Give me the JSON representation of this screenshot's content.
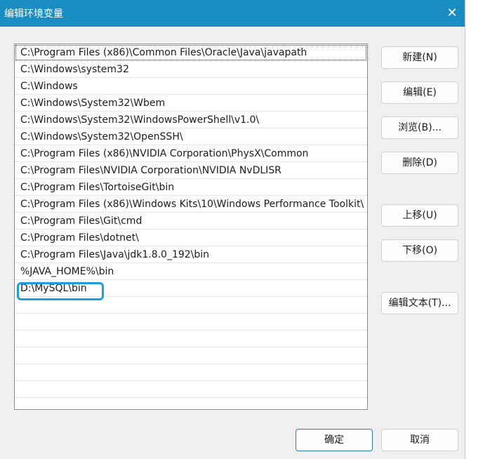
{
  "window": {
    "title": "编辑环境变量",
    "close_glyph": "✕"
  },
  "paths": [
    "C:\\Program Files (x86)\\Common Files\\Oracle\\Java\\javapath",
    "C:\\Windows\\system32",
    "C:\\Windows",
    "C:\\Windows\\System32\\Wbem",
    "C:\\Windows\\System32\\WindowsPowerShell\\v1.0\\",
    "C:\\Windows\\System32\\OpenSSH\\",
    "C:\\Program Files (x86)\\NVIDIA Corporation\\PhysX\\Common",
    "C:\\Program Files\\NVIDIA Corporation\\NVIDIA NvDLISR",
    "C:\\Program Files\\TortoiseGit\\bin",
    "C:\\Program Files (x86)\\Windows Kits\\10\\Windows Performance Toolkit\\",
    "C:\\Program Files\\Git\\cmd",
    "C:\\Program Files\\dotnet\\",
    "C:\\Program Files\\Java\\jdk1.8.0_192\\bin",
    "%JAVA_HOME%\\bin",
    "D:\\MySQL\\bin"
  ],
  "buttons": {
    "new": "新建(N)",
    "edit": "编辑(E)",
    "browse": "浏览(B)...",
    "delete": "删除(D)",
    "move_up": "上移(U)",
    "move_down": "下移(O)",
    "edit_text": "编辑文本(T)...",
    "ok": "确定",
    "cancel": "取消"
  },
  "colors": {
    "titlebar": "#1a8ec2",
    "highlight": "#1a9ee0"
  }
}
